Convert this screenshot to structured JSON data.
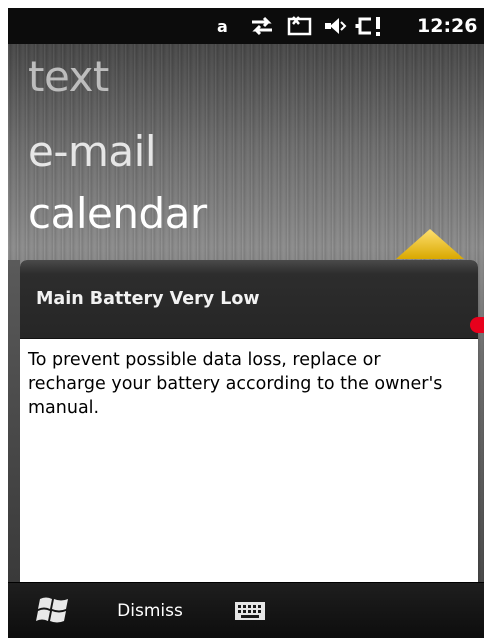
{
  "status_bar": {
    "input_mode": "a",
    "clock": "12:26",
    "icons": [
      "data-connection-icon",
      "sms-icon",
      "volume-muted-icon",
      "battery-icon"
    ]
  },
  "background_menu": {
    "items": [
      "text",
      "e-mail",
      "calendar"
    ]
  },
  "notification": {
    "title": "Main Battery Very Low",
    "message": "To prevent possible data loss, replace or recharge your battery according to the owner's manual."
  },
  "softkeys": {
    "start_icon": "windows-flag-icon",
    "dismiss_label": "Dismiss",
    "keyboard_icon": "keyboard-icon"
  },
  "colors": {
    "accent_arrow": "#f0c020",
    "notification_edge": "#e8001c"
  }
}
